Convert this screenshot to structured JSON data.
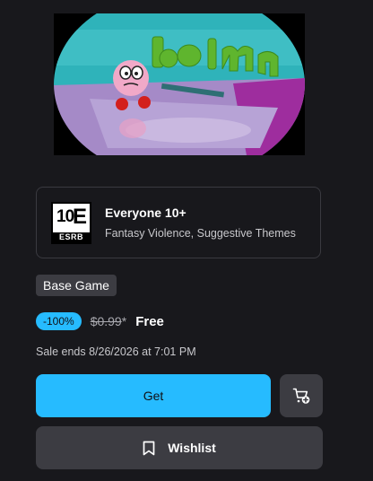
{
  "thumbnail": {
    "title_art": "bolmn"
  },
  "rating": {
    "badge_number": "10",
    "badge_letter": "E",
    "badge_org": "ESRB",
    "title": "Everyone 10+",
    "descriptors": "Fantasy Violence, Suggestive Themes"
  },
  "product_type": "Base Game",
  "price": {
    "discount": "-100%",
    "original": "$0.99",
    "original_marker": "*",
    "final": "Free"
  },
  "sale_ends": "Sale ends 8/26/2026 at 7:01 PM",
  "actions": {
    "get_label": "Get",
    "wishlist_label": "Wishlist"
  },
  "icons": {
    "cart": "add-to-cart-icon",
    "wishlist": "bookmark-icon"
  },
  "colors": {
    "background": "#18181c",
    "accent": "#26bbff",
    "button_secondary": "#3c3c42",
    "card_border": "#3a3a40"
  }
}
